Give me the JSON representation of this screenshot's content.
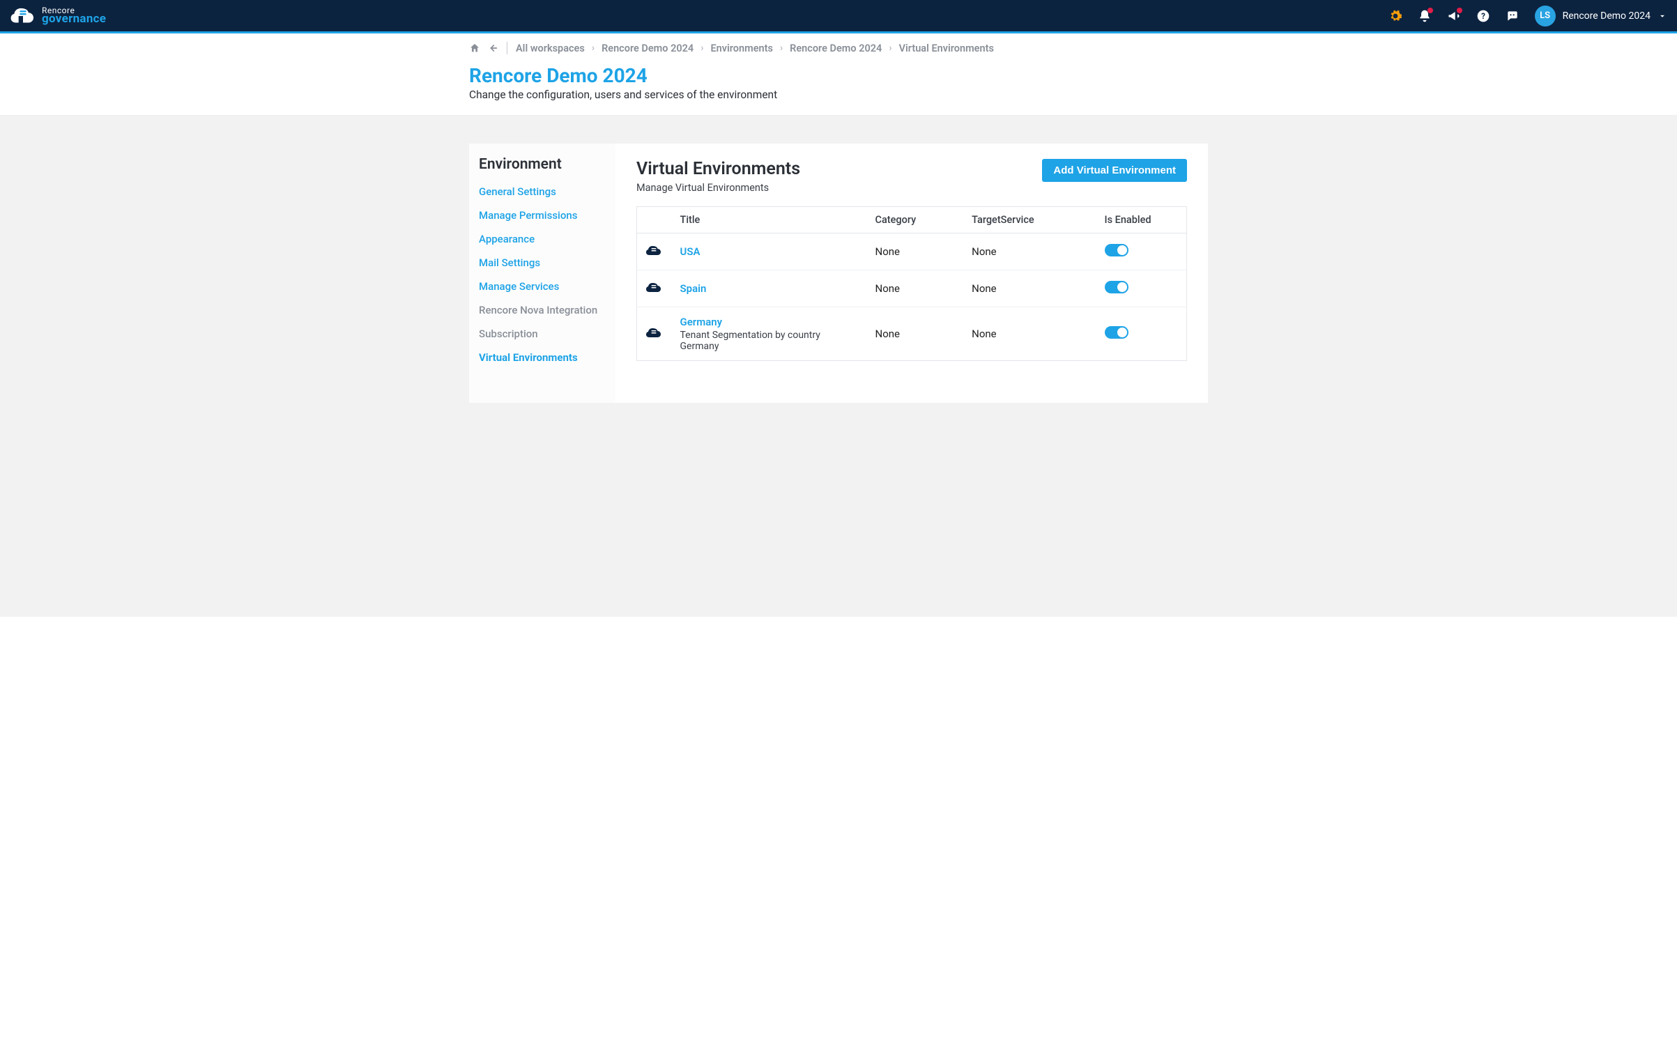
{
  "brand": {
    "line1": "Rencore",
    "line2": "governance"
  },
  "user": {
    "initials": "LS",
    "workspace": "Rencore Demo 2024"
  },
  "breadcrumbs": {
    "items": [
      "All workspaces",
      "Rencore Demo 2024",
      "Environments",
      "Rencore Demo 2024",
      "Virtual Environments"
    ]
  },
  "page": {
    "title": "Rencore Demo 2024",
    "subtitle": "Change the configuration, users and services of the environment"
  },
  "sidebar": {
    "title": "Environment",
    "items": [
      {
        "label": "General Settings",
        "state": "link"
      },
      {
        "label": "Manage Permissions",
        "state": "link"
      },
      {
        "label": "Appearance",
        "state": "link"
      },
      {
        "label": "Mail Settings",
        "state": "link"
      },
      {
        "label": "Manage Services",
        "state": "link"
      },
      {
        "label": "Rencore Nova Integration",
        "state": "muted"
      },
      {
        "label": "Subscription",
        "state": "muted"
      },
      {
        "label": "Virtual Environments",
        "state": "active"
      }
    ]
  },
  "content": {
    "title": "Virtual Environments",
    "subtitle": "Manage Virtual Environments",
    "add_button": "Add Virtual Environment",
    "columns": {
      "icon": "",
      "title": "Title",
      "category": "Category",
      "target": "TargetService",
      "enabled": "Is Enabled"
    },
    "rows": [
      {
        "title": "USA",
        "desc": "",
        "category": "None",
        "target": "None",
        "enabled": true
      },
      {
        "title": "Spain",
        "desc": "",
        "category": "None",
        "target": "None",
        "enabled": true
      },
      {
        "title": "Germany",
        "desc": "Tenant Segmentation by country Germany",
        "category": "None",
        "target": "None",
        "enabled": true
      }
    ]
  }
}
